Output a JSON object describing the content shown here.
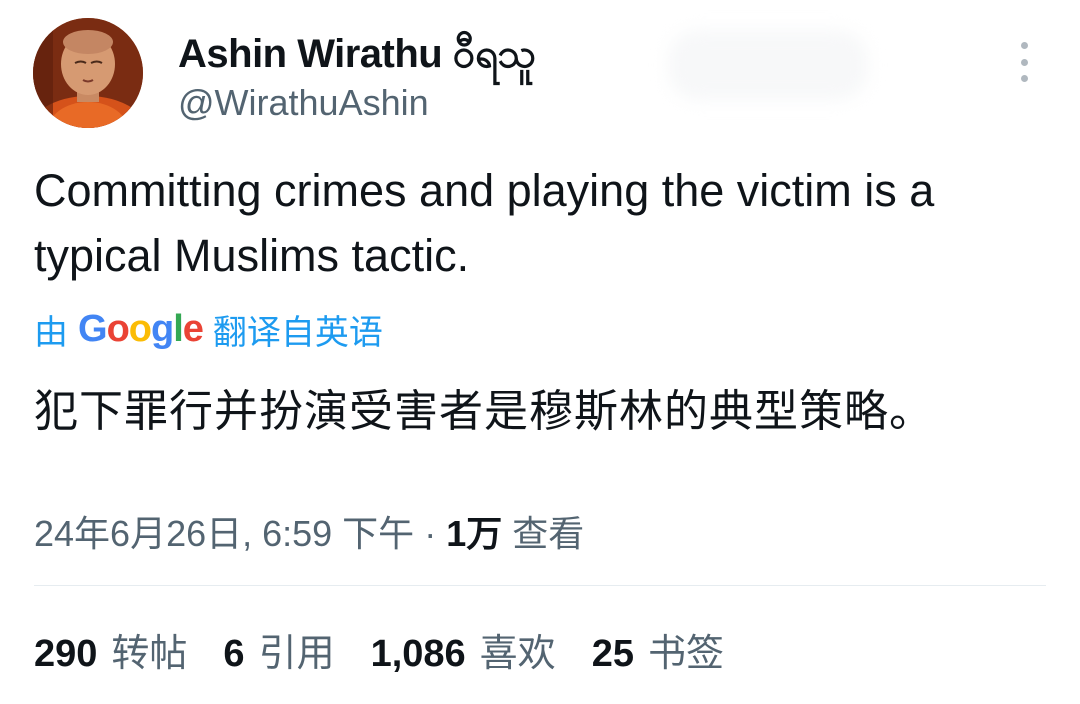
{
  "author": {
    "name": "Ashin Wirathu ဝီရသူ",
    "handle": "@WirathuAshin"
  },
  "tweet": {
    "text": "Committing crimes and playing the victim is a typical Muslims tactic.",
    "translation_prefix": "由",
    "translation_provider": "Google",
    "translation_suffix": "翻译自英语",
    "translated_text": "犯下罪行并扮演受害者是穆斯林的典型策略。"
  },
  "meta": {
    "date_time": "24年6月26日, 6:59 下午",
    "separator": " · ",
    "views_count": "1万",
    "views_label": "查看"
  },
  "stats": [
    {
      "count": "290",
      "label": "转帖"
    },
    {
      "count": "6",
      "label": "引用"
    },
    {
      "count": "1,086",
      "label": "喜欢"
    },
    {
      "count": "25",
      "label": "书签"
    }
  ],
  "colors": {
    "text": "#0f1419",
    "secondary": "#536471",
    "accent": "#1d9bf0",
    "divider": "#e6ecf0"
  },
  "icons": {
    "more": "more-vertical-icon"
  }
}
